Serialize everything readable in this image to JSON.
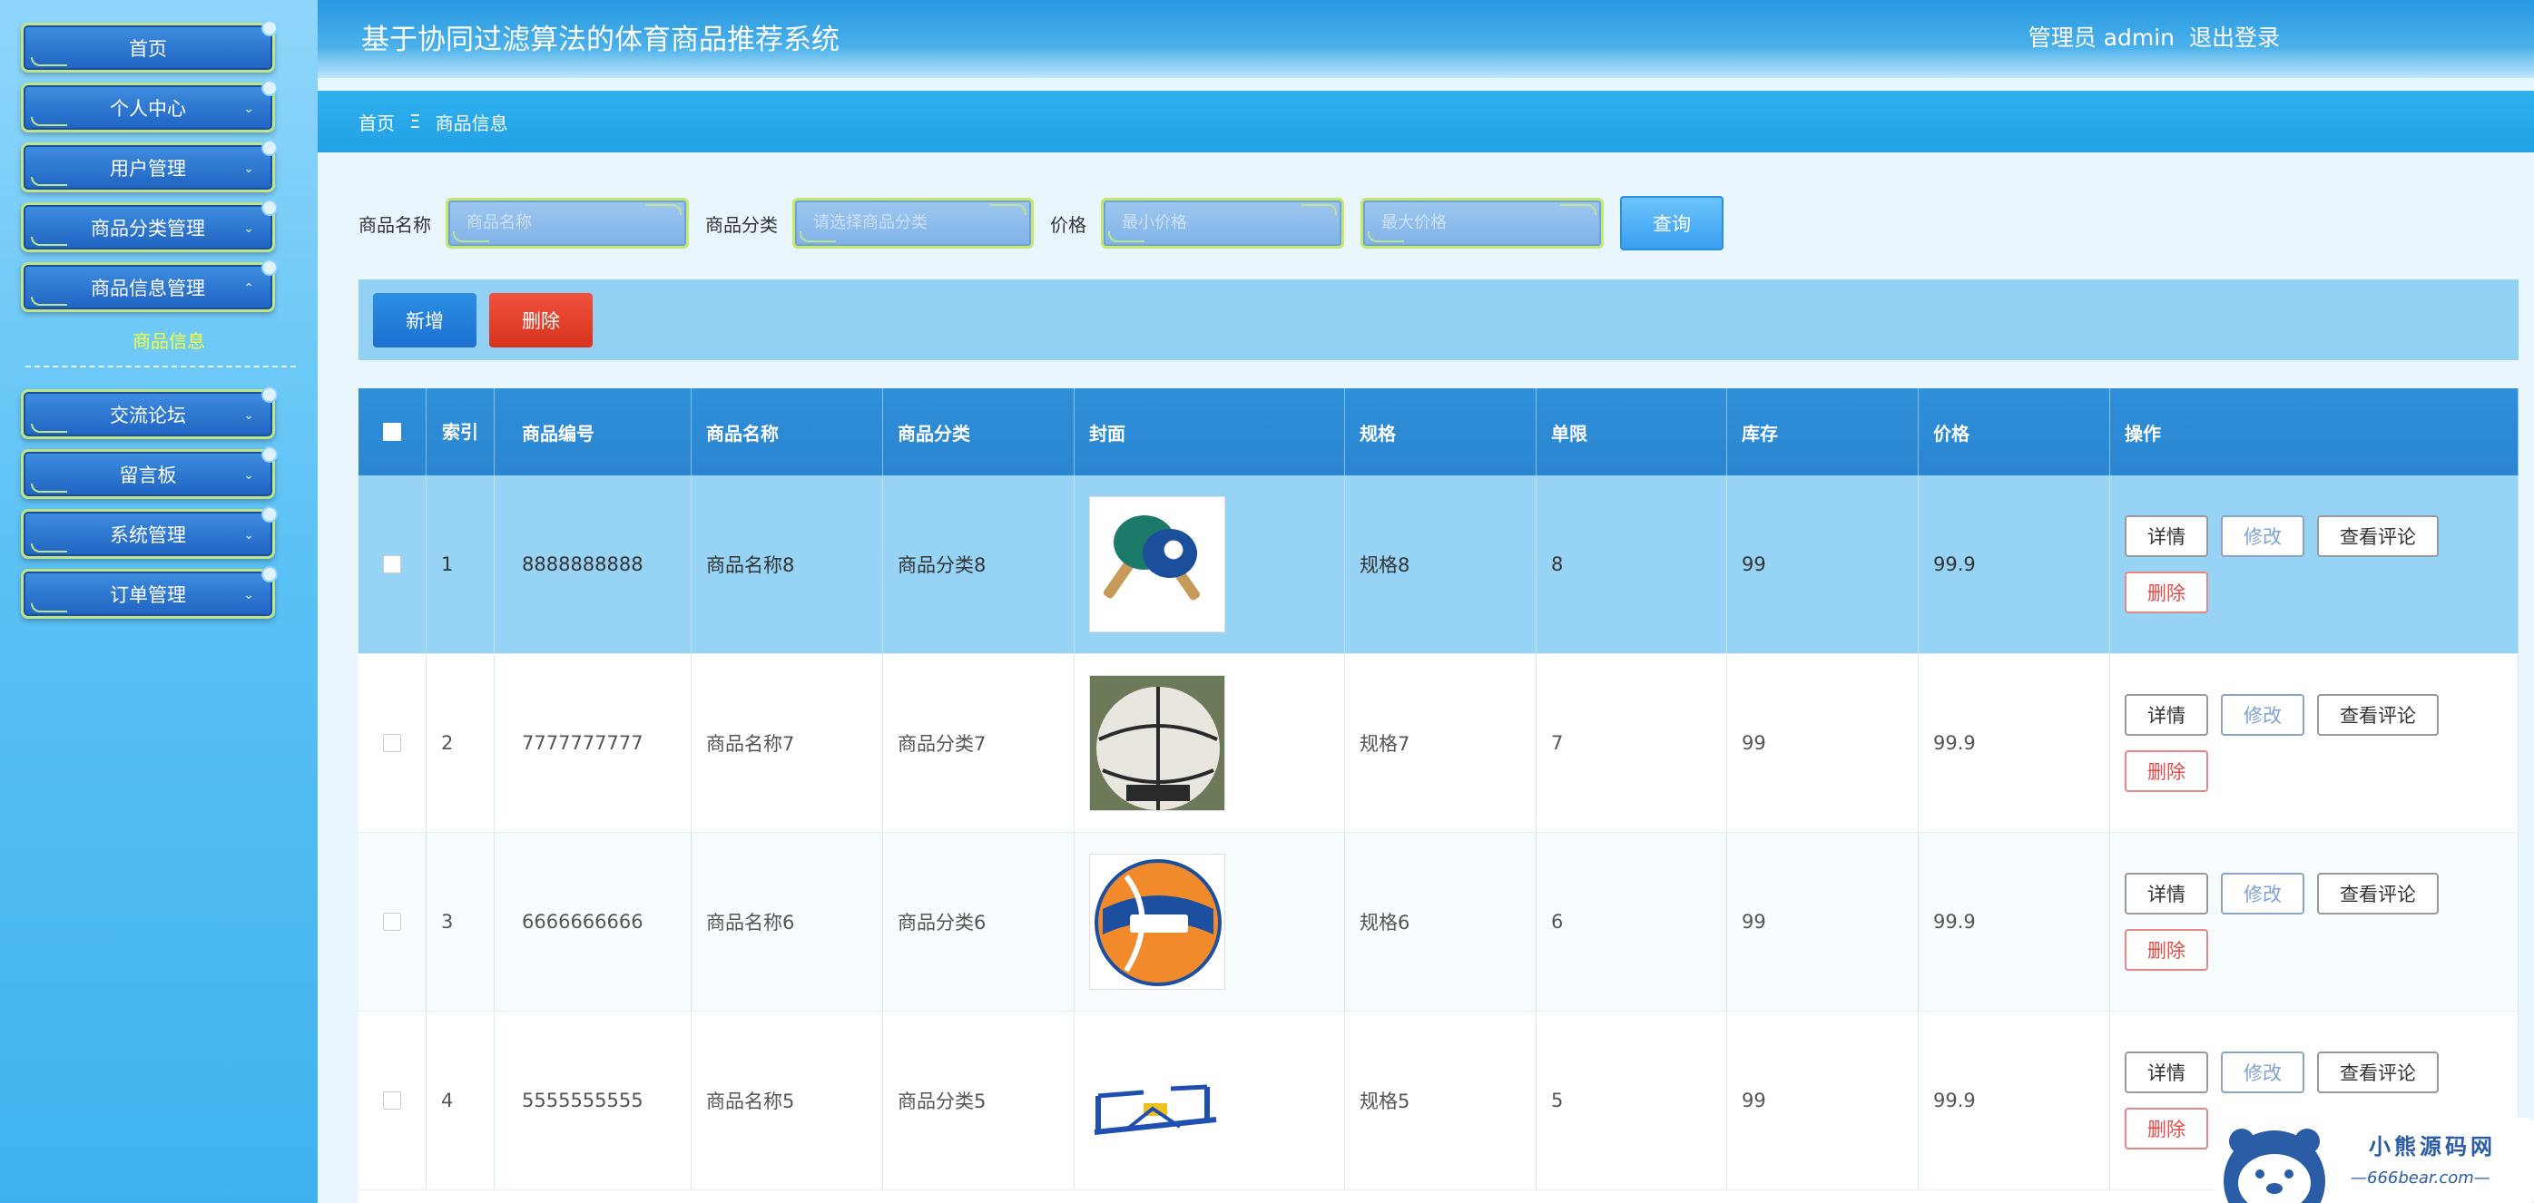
{
  "header": {
    "title": "基于协同过滤算法的体育商品推荐系统",
    "user_role": "管理员 admin",
    "logout": "退出登录"
  },
  "sidebar": {
    "items": [
      {
        "label": "首页"
      },
      {
        "label": "个人中心"
      },
      {
        "label": "用户管理"
      },
      {
        "label": "商品分类管理"
      },
      {
        "label": "商品信息管理"
      },
      {
        "label": "交流论坛"
      },
      {
        "label": "留言板"
      },
      {
        "label": "系统管理"
      },
      {
        "label": "订单管理"
      }
    ],
    "sub_active": "商品信息"
  },
  "breadcrumb": {
    "home": "首页",
    "separator": "Ξ",
    "current": "商品信息"
  },
  "search": {
    "name_label": "商品名称",
    "name_placeholder": "商品名称",
    "category_label": "商品分类",
    "category_placeholder": "请选择商品分类",
    "price_label": "价格",
    "price_min_placeholder": "最小价格",
    "price_max_placeholder": "最大价格",
    "query_button": "查询"
  },
  "actions": {
    "add": "新增",
    "delete": "删除"
  },
  "table": {
    "headers": {
      "index": "索引",
      "code": "商品编号",
      "name": "商品名称",
      "category": "商品分类",
      "cover": "封面",
      "spec": "规格",
      "limit": "单限",
      "stock": "库存",
      "price": "价格",
      "ops": "操作"
    },
    "rows": [
      {
        "index": "1",
        "code": "8888888888",
        "name": "商品名称8",
        "category": "商品分类8",
        "cover": "table-tennis-image",
        "spec": "规格8",
        "limit": "8",
        "stock": "99",
        "price": "99.9"
      },
      {
        "index": "2",
        "code": "7777777777",
        "name": "商品名称7",
        "category": "商品分类7",
        "cover": "basketball-image",
        "spec": "规格7",
        "limit": "7",
        "stock": "99",
        "price": "99.9"
      },
      {
        "index": "3",
        "code": "6666666666",
        "name": "商品名称6",
        "category": "商品分类6",
        "cover": "volleyball-image",
        "spec": "规格6",
        "limit": "6",
        "stock": "99",
        "price": "99.9"
      },
      {
        "index": "4",
        "code": "5555555555",
        "name": "商品名称5",
        "category": "商品分类5",
        "cover": "fitness-equipment-image",
        "spec": "规格5",
        "limit": "5",
        "stock": "99",
        "price": "99.9"
      }
    ],
    "ops": {
      "detail": "详情",
      "edit": "修改",
      "review": "查看评论",
      "delete": "删除"
    }
  },
  "watermark": {
    "name": "小熊源码网",
    "url": "—666bear.com—"
  }
}
